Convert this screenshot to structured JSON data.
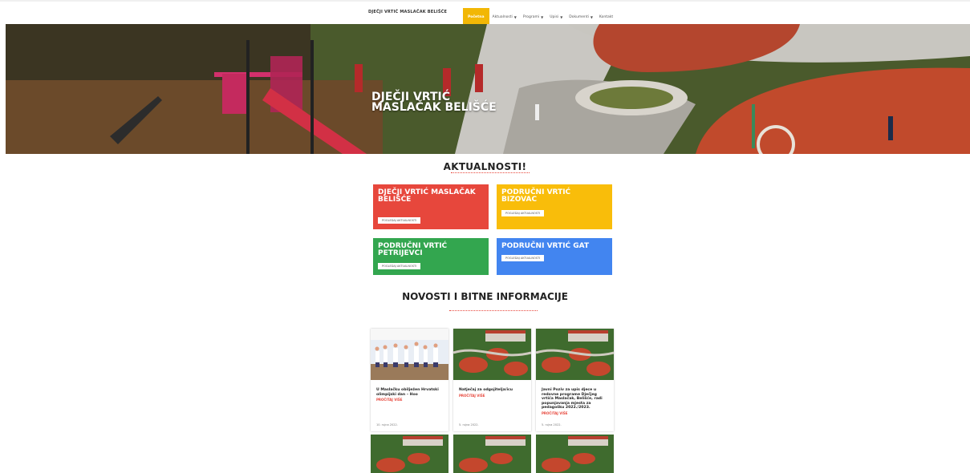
{
  "header": {
    "brand": "DJEČJI VRTIĆ MASLAČAK BELIŠĆE",
    "nav": [
      {
        "label": "Početna",
        "active": true,
        "dropdown": false
      },
      {
        "label": "Aktualnosti",
        "active": false,
        "dropdown": true
      },
      {
        "label": "Programi",
        "active": false,
        "dropdown": true
      },
      {
        "label": "Upisi",
        "active": false,
        "dropdown": true
      },
      {
        "label": "Dokumenti",
        "active": false,
        "dropdown": true
      },
      {
        "label": "Kontakt",
        "active": false,
        "dropdown": false
      }
    ]
  },
  "hero": {
    "title_line1": "DJEČJI VRTIĆ",
    "title_line2": "MASLAČAK BELIŠĆE"
  },
  "aktualnosti": {
    "title": "AKTUALNOSTI!",
    "cards": [
      {
        "title": "DJEČJI VRTIĆ MASLAČAK BELIŠĆE",
        "button": "POGLEDAJ AKTUALNOSTI",
        "color": "#e7473c"
      },
      {
        "title": "PODRUČNI VRTIĆ BIZOVAC",
        "button": "POGLEDAJ AKTUALNOSTI",
        "color": "#f9bd0a"
      },
      {
        "title": "PODRUČNI VRTIĆ PETRIJEVCI",
        "button": "POGLEDAJ AKTUALNOSTI",
        "color": "#33a64f"
      },
      {
        "title": "PODRUČNI VRTIĆ GAT",
        "button": "POGLEDAJ AKTUALNOSTI",
        "color": "#4285f0"
      }
    ]
  },
  "novosti": {
    "title": "NOVOSTI I BITNE INFORMACIJE",
    "items": [
      {
        "text": "U Maslačku obilježen Hrvatski olimpijski dan – Hoo",
        "more": "PROČITAJ VIŠE",
        "date": "10. rujna 2022."
      },
      {
        "text": "Natječaj za odgojitelja/icu",
        "more": "PROČITAJ VIŠE",
        "date": "5. rujna 2022."
      },
      {
        "text": "Javni Poziv za upis djece u redovne programe Dječjeg vrtića Maslačak, Belišće, radi popunjavanja mjesta za pedagošku 2022./2023.",
        "more": "PROČITAJ VIŠE",
        "date": "5. rujna 2022."
      }
    ]
  },
  "colors": {
    "accent_yellow": "#f2b705",
    "red": "#e7473c",
    "yellow": "#f9bd0a",
    "green": "#33a64f",
    "blue": "#4285f0"
  }
}
